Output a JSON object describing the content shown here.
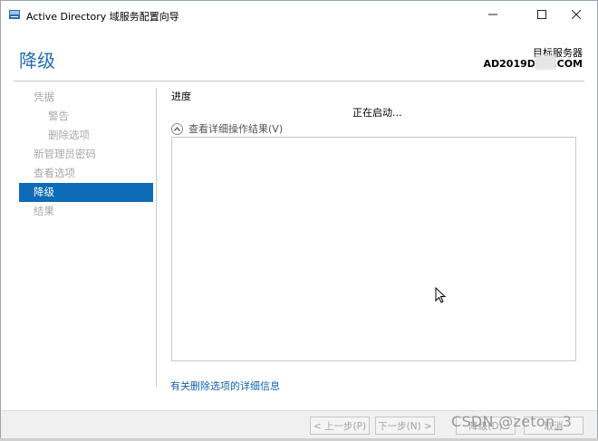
{
  "window": {
    "title": "Active Directory 域服务配置向导",
    "icon": "server-wizard-icon",
    "controls": [
      "minimize-icon",
      "maximize-icon",
      "close-icon"
    ]
  },
  "header": {
    "title": "降级",
    "target_label": "目标服务器",
    "target_value": "AD2019DC0            .COM"
  },
  "nav": {
    "items": [
      {
        "label": "凭据",
        "level": 0,
        "active": false
      },
      {
        "label": "警告",
        "level": 1,
        "active": false
      },
      {
        "label": "删除选项",
        "level": 1,
        "active": false
      },
      {
        "label": "新管理员密码",
        "level": 0,
        "active": false
      },
      {
        "label": "查看选项",
        "level": 0,
        "active": false
      },
      {
        "label": "降级",
        "level": 0,
        "active": true
      },
      {
        "label": "结果",
        "level": 0,
        "active": false
      }
    ]
  },
  "main": {
    "section_title": "进度",
    "status": "正在启动...",
    "expander_label": "查看详细操作结果(V)",
    "more_info_link": "有关删除选项的详细信息"
  },
  "footer": {
    "prev": "< 上一步(P)",
    "next": "下一步(N) >",
    "install": "降级(D)",
    "cancel": "取消"
  },
  "watermark": "CSDN @zeton_3",
  "colors": {
    "accent": "#0e6bb8",
    "title_blue": "#1e6fb4",
    "link": "#1462b4",
    "disabled_text": "#a9a9a9"
  }
}
